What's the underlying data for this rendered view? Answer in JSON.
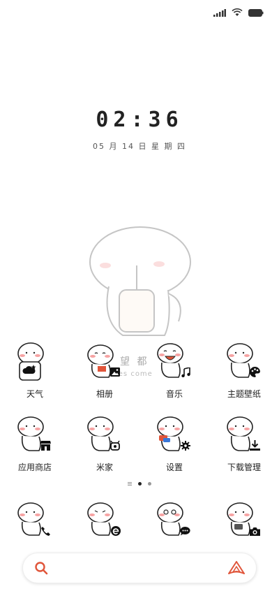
{
  "status_bar": {
    "icons": [
      "signal-icon",
      "wifi-icon",
      "battery-icon"
    ]
  },
  "lock": {
    "time": "02:36",
    "date": "05 月 14 日   星 期 四"
  },
  "wallpaper_text": {
    "line1": "望 都",
    "line2": "ies come"
  },
  "apps_row1": [
    {
      "label": "天气",
      "badge": "weather-icon"
    },
    {
      "label": "相册",
      "badge": "gallery-icon"
    },
    {
      "label": "音乐",
      "badge": "music-icon"
    },
    {
      "label": "主题壁纸",
      "badge": "palette-icon"
    }
  ],
  "apps_row2": [
    {
      "label": "应用商店",
      "badge": "store-icon"
    },
    {
      "label": "米家",
      "badge": "mijia-icon"
    },
    {
      "label": "设置",
      "badge": "gear-icon"
    },
    {
      "label": "下载管理",
      "badge": "download-icon"
    }
  ],
  "dock": [
    {
      "badge": "phone-icon"
    },
    {
      "badge": "browser-icon"
    },
    {
      "badge": "message-icon"
    },
    {
      "badge": "camera-icon"
    }
  ],
  "pager": {
    "current_page": 2,
    "total_pages": 2
  },
  "search": {
    "left_icon": "search-icon",
    "right_icon": "assistant-icon"
  },
  "colors": {
    "accent": "#e0553a"
  }
}
